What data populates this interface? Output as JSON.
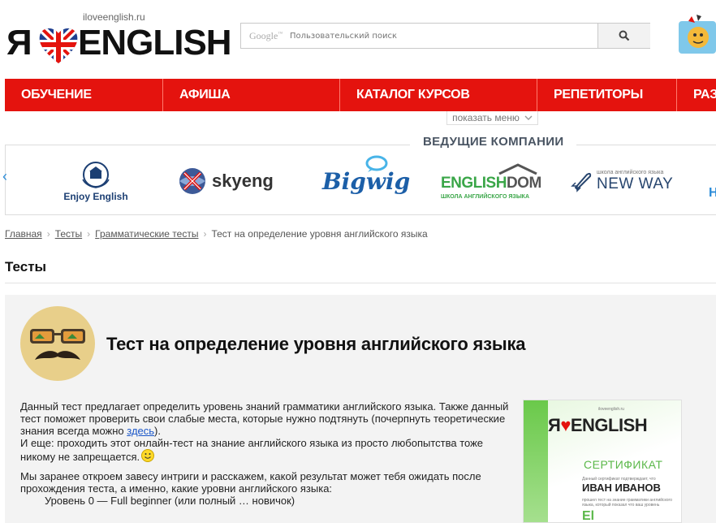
{
  "header": {
    "logo_domain": "iloveenglish.ru",
    "logo_ya": "Я",
    "logo_english": "ENGLISH",
    "search_placeholder": "Пользовательский поиск",
    "google_label": "Google"
  },
  "nav": {
    "items": [
      {
        "label": "ОБУЧЕНИЕ"
      },
      {
        "label": "АФИША"
      },
      {
        "label": "КАТАЛОГ КУРСОВ"
      },
      {
        "label": "РЕПЕТИТОРЫ"
      },
      {
        "label": "РАЗ"
      }
    ],
    "show_menu": "показать меню"
  },
  "companies": {
    "title": "ВЕДУЩИЕ КОМПАНИИ",
    "items": [
      {
        "name": "Enjoy English"
      },
      {
        "name": "skyeng"
      },
      {
        "name": "Bigwig"
      },
      {
        "name": "ENGLISH",
        "name2": "DOM",
        "subtitle": "ШКОЛА АНГЛИЙСКОГО ЯЗЫКА"
      },
      {
        "name": "NEW WAY",
        "subtitle": "школа английского языка"
      }
    ],
    "next_partial": "H"
  },
  "breadcrumb": {
    "items": [
      "Главная",
      "Тесты",
      "Грамматические тесты"
    ],
    "current": "Тест на определение уровня английского языка"
  },
  "section_title": "Тесты",
  "test": {
    "title": "Тест на определение уровня английского языка",
    "p1_text": "Данный тест предлагает определить уровень знаний грамматики английского языка. Также данный тест поможет проверить свои слабые места, которые нужно подтянуть (почерпнуть теоретические знания всегда можно ",
    "p1_link": "здесь",
    "p1_end": ").",
    "p2": "И еще: проходить этот онлайн-тест на знание английского языка из просто любопытства тоже никому не запрещается.",
    "p3": "Мы заранее откроем завесу интриги и расскажем, какой результат может тебя ожидать после прохождения теста, а именно, какие уровни английского языка:",
    "level0": "Уровень 0 — Full beginner (или полный … новичок)"
  },
  "certificate": {
    "domain": "iloveenglish.ru",
    "logo_ya": "Я",
    "logo_english": "ENGLISH",
    "title": "СЕРТИФИКАТ",
    "small1": "Данный сертификат подтверждает, что",
    "name": "ИВАН ИВАНОВ",
    "small2": "прошел тест на знание грамматики английского языка, который показал что ваш уровень",
    "level": "El"
  },
  "colors": {
    "nav_red": "#e4130e",
    "link_blue": "#1a56c8",
    "cert_green": "#5bb84a"
  }
}
